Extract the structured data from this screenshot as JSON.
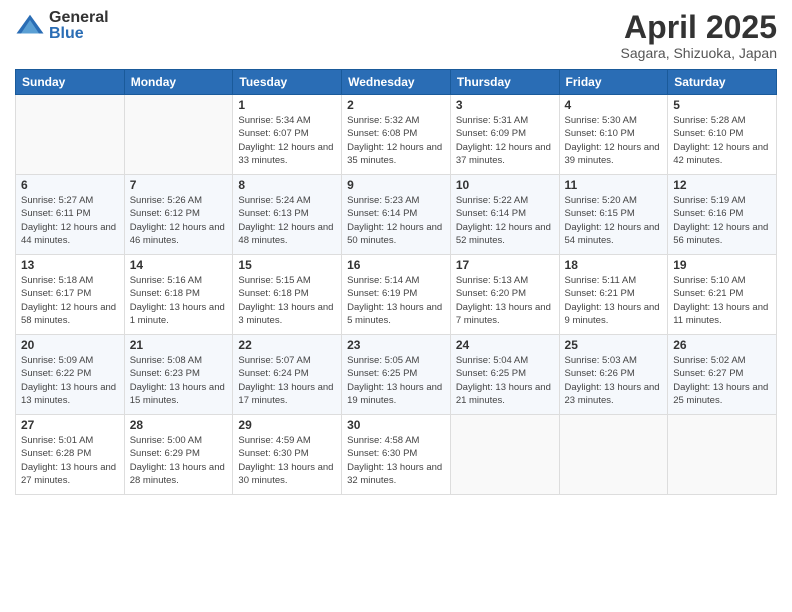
{
  "logo": {
    "general": "General",
    "blue": "Blue"
  },
  "title": "April 2025",
  "subtitle": "Sagara, Shizuoka, Japan",
  "days_of_week": [
    "Sunday",
    "Monday",
    "Tuesday",
    "Wednesday",
    "Thursday",
    "Friday",
    "Saturday"
  ],
  "weeks": [
    [
      {
        "day": "",
        "sunrise": "",
        "sunset": "",
        "daylight": ""
      },
      {
        "day": "",
        "sunrise": "",
        "sunset": "",
        "daylight": ""
      },
      {
        "day": "1",
        "sunrise": "Sunrise: 5:34 AM",
        "sunset": "Sunset: 6:07 PM",
        "daylight": "Daylight: 12 hours and 33 minutes."
      },
      {
        "day": "2",
        "sunrise": "Sunrise: 5:32 AM",
        "sunset": "Sunset: 6:08 PM",
        "daylight": "Daylight: 12 hours and 35 minutes."
      },
      {
        "day": "3",
        "sunrise": "Sunrise: 5:31 AM",
        "sunset": "Sunset: 6:09 PM",
        "daylight": "Daylight: 12 hours and 37 minutes."
      },
      {
        "day": "4",
        "sunrise": "Sunrise: 5:30 AM",
        "sunset": "Sunset: 6:10 PM",
        "daylight": "Daylight: 12 hours and 39 minutes."
      },
      {
        "day": "5",
        "sunrise": "Sunrise: 5:28 AM",
        "sunset": "Sunset: 6:10 PM",
        "daylight": "Daylight: 12 hours and 42 minutes."
      }
    ],
    [
      {
        "day": "6",
        "sunrise": "Sunrise: 5:27 AM",
        "sunset": "Sunset: 6:11 PM",
        "daylight": "Daylight: 12 hours and 44 minutes."
      },
      {
        "day": "7",
        "sunrise": "Sunrise: 5:26 AM",
        "sunset": "Sunset: 6:12 PM",
        "daylight": "Daylight: 12 hours and 46 minutes."
      },
      {
        "day": "8",
        "sunrise": "Sunrise: 5:24 AM",
        "sunset": "Sunset: 6:13 PM",
        "daylight": "Daylight: 12 hours and 48 minutes."
      },
      {
        "day": "9",
        "sunrise": "Sunrise: 5:23 AM",
        "sunset": "Sunset: 6:14 PM",
        "daylight": "Daylight: 12 hours and 50 minutes."
      },
      {
        "day": "10",
        "sunrise": "Sunrise: 5:22 AM",
        "sunset": "Sunset: 6:14 PM",
        "daylight": "Daylight: 12 hours and 52 minutes."
      },
      {
        "day": "11",
        "sunrise": "Sunrise: 5:20 AM",
        "sunset": "Sunset: 6:15 PM",
        "daylight": "Daylight: 12 hours and 54 minutes."
      },
      {
        "day": "12",
        "sunrise": "Sunrise: 5:19 AM",
        "sunset": "Sunset: 6:16 PM",
        "daylight": "Daylight: 12 hours and 56 minutes."
      }
    ],
    [
      {
        "day": "13",
        "sunrise": "Sunrise: 5:18 AM",
        "sunset": "Sunset: 6:17 PM",
        "daylight": "Daylight: 12 hours and 58 minutes."
      },
      {
        "day": "14",
        "sunrise": "Sunrise: 5:16 AM",
        "sunset": "Sunset: 6:18 PM",
        "daylight": "Daylight: 13 hours and 1 minute."
      },
      {
        "day": "15",
        "sunrise": "Sunrise: 5:15 AM",
        "sunset": "Sunset: 6:18 PM",
        "daylight": "Daylight: 13 hours and 3 minutes."
      },
      {
        "day": "16",
        "sunrise": "Sunrise: 5:14 AM",
        "sunset": "Sunset: 6:19 PM",
        "daylight": "Daylight: 13 hours and 5 minutes."
      },
      {
        "day": "17",
        "sunrise": "Sunrise: 5:13 AM",
        "sunset": "Sunset: 6:20 PM",
        "daylight": "Daylight: 13 hours and 7 minutes."
      },
      {
        "day": "18",
        "sunrise": "Sunrise: 5:11 AM",
        "sunset": "Sunset: 6:21 PM",
        "daylight": "Daylight: 13 hours and 9 minutes."
      },
      {
        "day": "19",
        "sunrise": "Sunrise: 5:10 AM",
        "sunset": "Sunset: 6:21 PM",
        "daylight": "Daylight: 13 hours and 11 minutes."
      }
    ],
    [
      {
        "day": "20",
        "sunrise": "Sunrise: 5:09 AM",
        "sunset": "Sunset: 6:22 PM",
        "daylight": "Daylight: 13 hours and 13 minutes."
      },
      {
        "day": "21",
        "sunrise": "Sunrise: 5:08 AM",
        "sunset": "Sunset: 6:23 PM",
        "daylight": "Daylight: 13 hours and 15 minutes."
      },
      {
        "day": "22",
        "sunrise": "Sunrise: 5:07 AM",
        "sunset": "Sunset: 6:24 PM",
        "daylight": "Daylight: 13 hours and 17 minutes."
      },
      {
        "day": "23",
        "sunrise": "Sunrise: 5:05 AM",
        "sunset": "Sunset: 6:25 PM",
        "daylight": "Daylight: 13 hours and 19 minutes."
      },
      {
        "day": "24",
        "sunrise": "Sunrise: 5:04 AM",
        "sunset": "Sunset: 6:25 PM",
        "daylight": "Daylight: 13 hours and 21 minutes."
      },
      {
        "day": "25",
        "sunrise": "Sunrise: 5:03 AM",
        "sunset": "Sunset: 6:26 PM",
        "daylight": "Daylight: 13 hours and 23 minutes."
      },
      {
        "day": "26",
        "sunrise": "Sunrise: 5:02 AM",
        "sunset": "Sunset: 6:27 PM",
        "daylight": "Daylight: 13 hours and 25 minutes."
      }
    ],
    [
      {
        "day": "27",
        "sunrise": "Sunrise: 5:01 AM",
        "sunset": "Sunset: 6:28 PM",
        "daylight": "Daylight: 13 hours and 27 minutes."
      },
      {
        "day": "28",
        "sunrise": "Sunrise: 5:00 AM",
        "sunset": "Sunset: 6:29 PM",
        "daylight": "Daylight: 13 hours and 28 minutes."
      },
      {
        "day": "29",
        "sunrise": "Sunrise: 4:59 AM",
        "sunset": "Sunset: 6:30 PM",
        "daylight": "Daylight: 13 hours and 30 minutes."
      },
      {
        "day": "30",
        "sunrise": "Sunrise: 4:58 AM",
        "sunset": "Sunset: 6:30 PM",
        "daylight": "Daylight: 13 hours and 32 minutes."
      },
      {
        "day": "",
        "sunrise": "",
        "sunset": "",
        "daylight": ""
      },
      {
        "day": "",
        "sunrise": "",
        "sunset": "",
        "daylight": ""
      },
      {
        "day": "",
        "sunrise": "",
        "sunset": "",
        "daylight": ""
      }
    ]
  ]
}
